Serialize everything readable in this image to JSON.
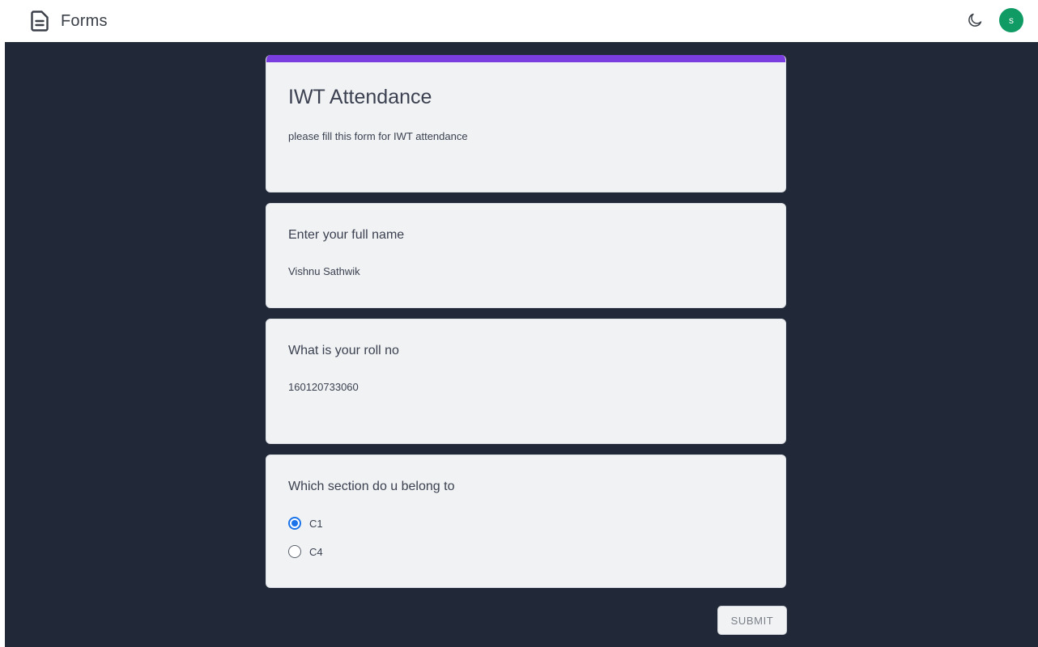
{
  "app": {
    "title": "Forms",
    "brand_icon": "document-icon",
    "theme_toggle_icon": "moon-icon",
    "avatar_initial": "s",
    "avatar_color": "#109a64"
  },
  "colors": {
    "background": "#212938",
    "card": "#f1f2f4",
    "accent": "#7a3ddf",
    "radio_selected": "#1a73e8"
  },
  "form": {
    "title": "IWT Attendance",
    "description": "please fill this form for IWT attendance"
  },
  "questions": [
    {
      "label": "Enter your full name",
      "answer": "Vishnu Sathwik"
    },
    {
      "label": "What is your roll no",
      "answer": "160120733060"
    },
    {
      "label": "Which section do u belong to",
      "options": [
        {
          "label": "C1",
          "selected": true
        },
        {
          "label": "C4",
          "selected": false
        }
      ]
    }
  ],
  "submit_label": "SUBMIT"
}
